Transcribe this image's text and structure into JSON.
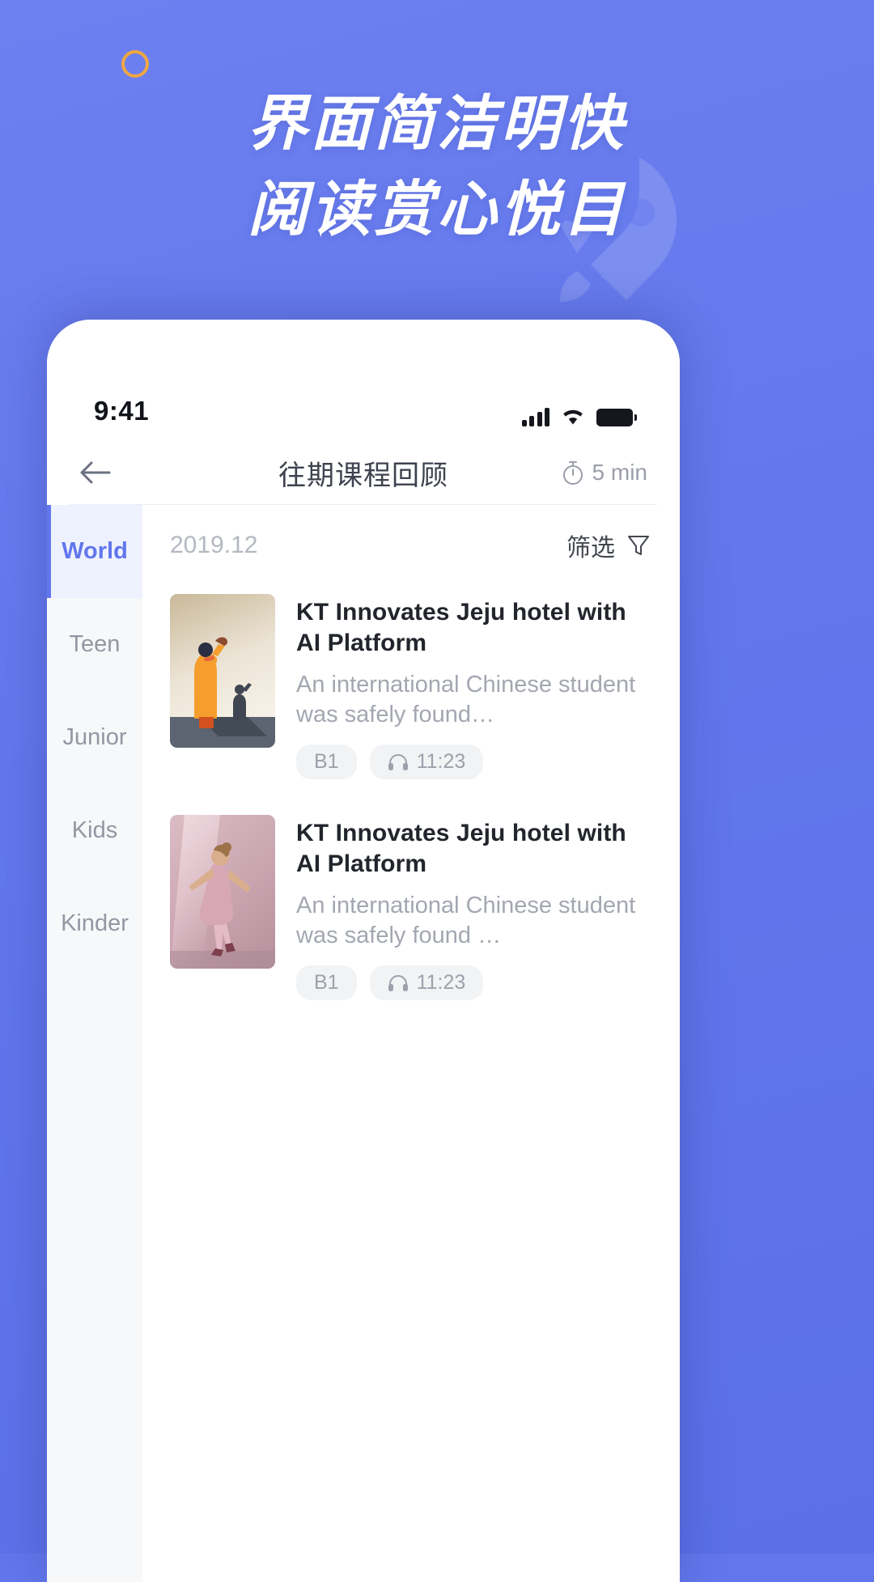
{
  "promo": {
    "headline_line1": "界面简洁明快",
    "headline_line2": "阅读赏心悦目",
    "accent_color": "#f0a742",
    "background_color": "#6277ec"
  },
  "status_bar": {
    "time": "9:41",
    "cellular_icon": "signal-bars-icon",
    "wifi_icon": "wifi-icon",
    "battery_icon": "battery-full-icon"
  },
  "navbar": {
    "back_icon": "back-arrow-icon",
    "title": "往期课程回顾",
    "timer_icon": "stopwatch-icon",
    "timer_label": "5 min"
  },
  "sidebar": {
    "active_index": 0,
    "items": [
      {
        "label": "World"
      },
      {
        "label": "Teen"
      },
      {
        "label": "Junior"
      },
      {
        "label": "Kids"
      },
      {
        "label": "Kinder"
      }
    ]
  },
  "list_header": {
    "date": "2019.12",
    "filter_label": "筛选",
    "filter_icon": "funnel-icon"
  },
  "articles": [
    {
      "title": "KT Innovates Jeju hotel with AI Platform",
      "description": "An international Chinese student was safely found…",
      "level": "B1",
      "audio_icon": "headphones-icon",
      "duration": "11:23",
      "thumb": "person-waving-illustration"
    },
    {
      "title": "KT Innovates Jeju hotel with AI Platform",
      "description": "An international Chinese student was safely found …",
      "level": "B1",
      "audio_icon": "headphones-icon",
      "duration": "11:23",
      "thumb": "dancing-girl-photo"
    }
  ]
}
